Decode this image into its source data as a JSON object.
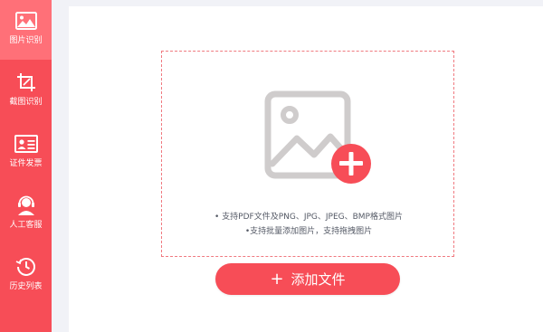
{
  "sidebar": {
    "items": [
      {
        "label": "图片识别",
        "icon": "image-icon",
        "active": true
      },
      {
        "label": "截图识别",
        "icon": "crop-icon",
        "active": false
      },
      {
        "label": "证件发票",
        "icon": "id-card-icon",
        "active": false
      },
      {
        "label": "人工客服",
        "icon": "headset-icon",
        "active": false
      },
      {
        "label": "历史列表",
        "icon": "history-icon",
        "active": false
      }
    ]
  },
  "upload": {
    "hint_line1": "• 支持PDF文件及PNG、JPG、JPEG、BMP格式图片",
    "hint_line2": "•支持批量添加图片，支持拖拽图片",
    "button_plus": "+",
    "button_label": "添加文件"
  },
  "colors": {
    "accent": "#f74d57",
    "active_nav": "#ff7078",
    "placeholder_gray": "#cfcccc"
  }
}
